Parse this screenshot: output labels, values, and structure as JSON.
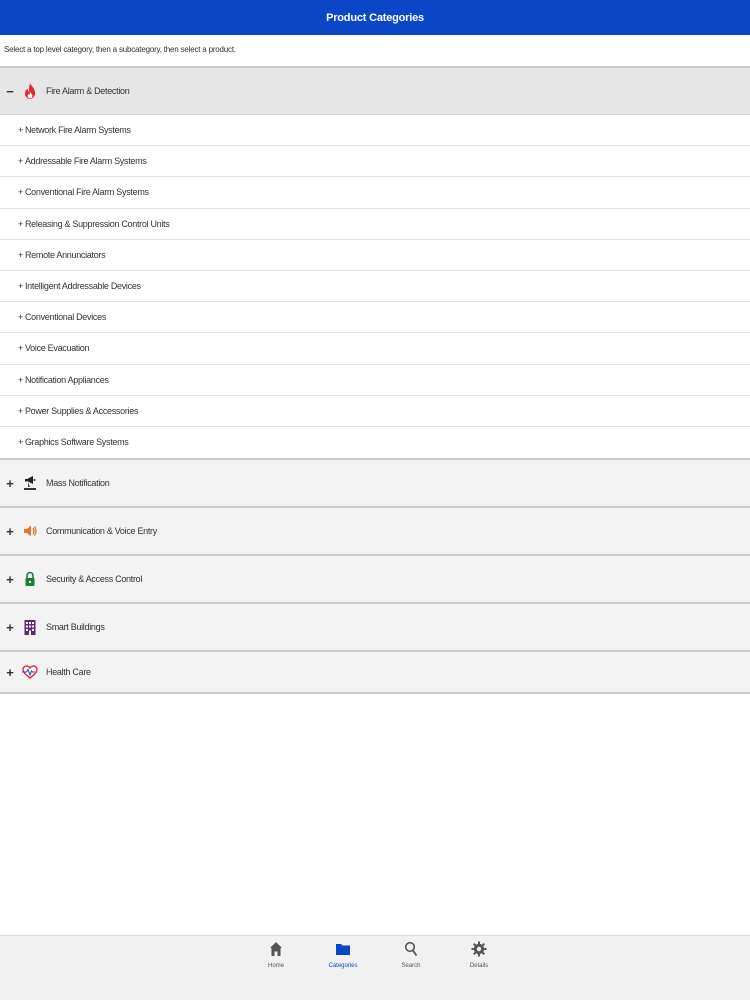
{
  "header": {
    "title": "Product Categories"
  },
  "instructions": "Select a top level category, then a subcategory, then select a product.",
  "categories": [
    {
      "label": "Fire Alarm & Detection",
      "toggle": "−",
      "icon": "flame-icon",
      "expanded": true,
      "subcategories": [
        "Network Fire Alarm Systems",
        "Addressable Fire Alarm Systems",
        "Conventional Fire Alarm Systems",
        "Releasing & Suppression Control Units",
        "Remote Annunciators",
        "Intelligent Addressable Devices",
        "Conventional Devices",
        "Voice Evacuation",
        "Notification Appliances",
        "Power Supplies & Accessories",
        "Graphics Software Systems"
      ]
    },
    {
      "label": "Mass Notification",
      "toggle": "+",
      "icon": "megaphone-icon",
      "expanded": false
    },
    {
      "label": "Communication & Voice Entry",
      "toggle": "+",
      "icon": "speaker-icon",
      "expanded": false
    },
    {
      "label": "Security & Access Control",
      "toggle": "+",
      "icon": "lock-icon",
      "expanded": false
    },
    {
      "label": "Smart Buildings",
      "toggle": "+",
      "icon": "building-icon",
      "expanded": false
    },
    {
      "label": "Health Care",
      "toggle": "+",
      "icon": "heart-pulse-icon",
      "expanded": false
    }
  ],
  "sub_prefix": "+ ",
  "bottom_nav": [
    {
      "label": "Home",
      "icon": "home-icon",
      "active": false
    },
    {
      "label": "Categories",
      "icon": "folder-icon",
      "active": true
    },
    {
      "label": "Search",
      "icon": "search-icon",
      "active": false
    },
    {
      "label": "Details",
      "icon": "gear-icon",
      "active": false
    }
  ],
  "colors": {
    "header_bg": "#0a47c6",
    "active_nav": "#0a47c6",
    "flame": "#e3262a",
    "speaker": "#e8742c",
    "lock": "#1f7a3c",
    "building": "#5c2a6e",
    "heart": "#d81f3a"
  }
}
